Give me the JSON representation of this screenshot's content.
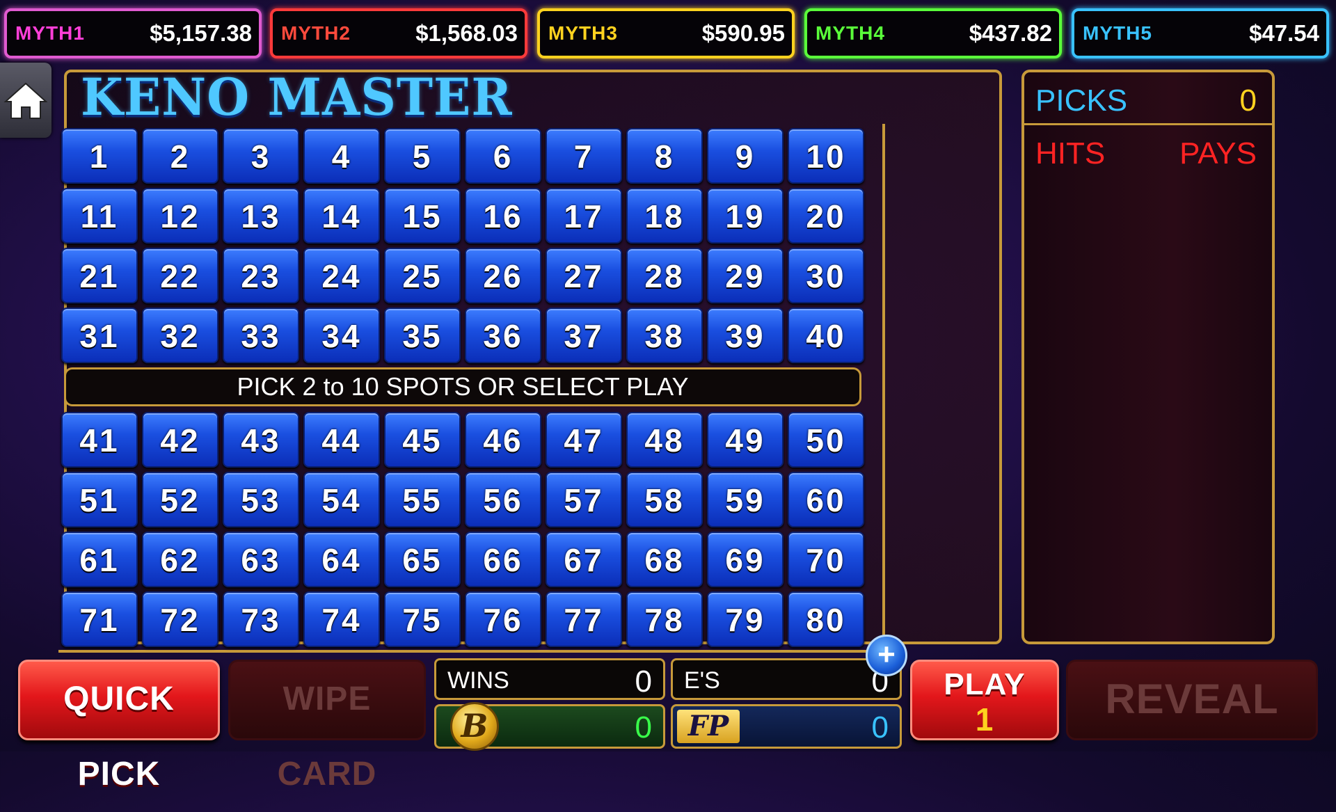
{
  "jackpots": [
    {
      "name": "MYTH1",
      "value": "$5,157.38",
      "color": "#ff3fd8",
      "border": "#e05ad0"
    },
    {
      "name": "MYTH2",
      "value": "$1,568.03",
      "color": "#ff4a3c",
      "border": "#ff3a3a"
    },
    {
      "name": "MYTH3",
      "value": "$590.95",
      "color": "#ffd21f",
      "border": "#ffd21f"
    },
    {
      "name": "MYTH4",
      "value": "$437.82",
      "color": "#5aff3a",
      "border": "#5aff3a"
    },
    {
      "name": "MYTH5",
      "value": "$47.54",
      "color": "#39c2ff",
      "border": "#39c2ff"
    }
  ],
  "game": {
    "title": "KENO MASTER",
    "message": "PICK 2 to 10 SPOTS OR SELECT PLAY",
    "numbers_top": [
      "1",
      "2",
      "3",
      "4",
      "5",
      "6",
      "7",
      "8",
      "9",
      "10",
      "11",
      "12",
      "13",
      "14",
      "15",
      "16",
      "17",
      "18",
      "19",
      "20",
      "21",
      "22",
      "23",
      "24",
      "25",
      "26",
      "27",
      "28",
      "29",
      "30",
      "31",
      "32",
      "33",
      "34",
      "35",
      "36",
      "37",
      "38",
      "39",
      "40"
    ],
    "numbers_bottom": [
      "41",
      "42",
      "43",
      "44",
      "45",
      "46",
      "47",
      "48",
      "49",
      "50",
      "51",
      "52",
      "53",
      "54",
      "55",
      "56",
      "57",
      "58",
      "59",
      "60",
      "61",
      "62",
      "63",
      "64",
      "65",
      "66",
      "67",
      "68",
      "69",
      "70",
      "71",
      "72",
      "73",
      "74",
      "75",
      "76",
      "77",
      "78",
      "79",
      "80"
    ]
  },
  "picks_panel": {
    "picks_label": "PICKS",
    "picks_value": "0",
    "hits_label": "HITS",
    "pays_label": "PAYS"
  },
  "controls": {
    "quick_pick": "QUICK PICK",
    "wipe_card": "WIPE CARD",
    "play_label": "PLAY",
    "play_value": "1",
    "reveal": "REVEAL",
    "plus": "+"
  },
  "stats": {
    "wins_label": "WINS",
    "wins_value": "0",
    "es_label": "E'S",
    "es_value": "0",
    "bonus_badge": "B",
    "bonus_value": "0",
    "fp_badge": "FP",
    "fp_value": "0"
  }
}
